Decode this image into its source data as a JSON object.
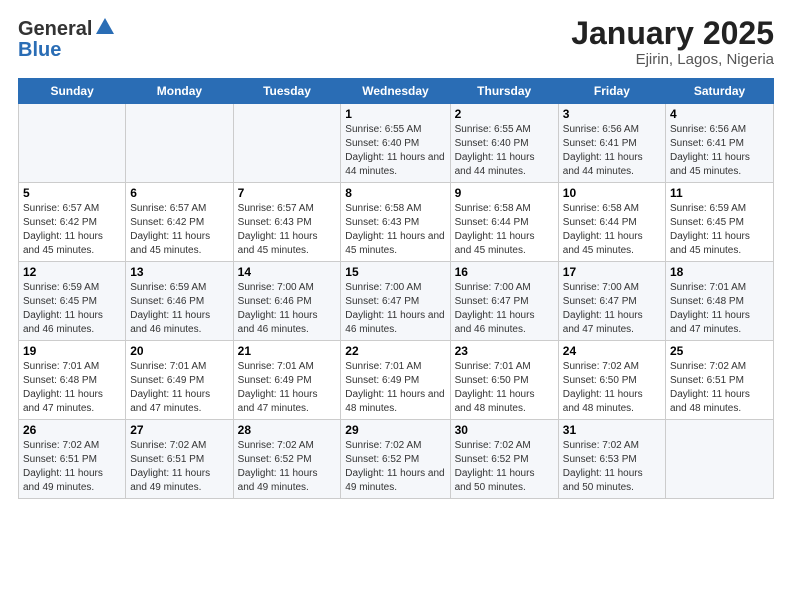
{
  "header": {
    "logo_general": "General",
    "logo_blue": "Blue",
    "title": "January 2025",
    "subtitle": "Ejirin, Lagos, Nigeria"
  },
  "days_of_week": [
    "Sunday",
    "Monday",
    "Tuesday",
    "Wednesday",
    "Thursday",
    "Friday",
    "Saturday"
  ],
  "weeks": [
    [
      {
        "day": "",
        "info": ""
      },
      {
        "day": "",
        "info": ""
      },
      {
        "day": "",
        "info": ""
      },
      {
        "day": "1",
        "info": "Sunrise: 6:55 AM\nSunset: 6:40 PM\nDaylight: 11 hours and 44 minutes."
      },
      {
        "day": "2",
        "info": "Sunrise: 6:55 AM\nSunset: 6:40 PM\nDaylight: 11 hours and 44 minutes."
      },
      {
        "day": "3",
        "info": "Sunrise: 6:56 AM\nSunset: 6:41 PM\nDaylight: 11 hours and 44 minutes."
      },
      {
        "day": "4",
        "info": "Sunrise: 6:56 AM\nSunset: 6:41 PM\nDaylight: 11 hours and 45 minutes."
      }
    ],
    [
      {
        "day": "5",
        "info": "Sunrise: 6:57 AM\nSunset: 6:42 PM\nDaylight: 11 hours and 45 minutes."
      },
      {
        "day": "6",
        "info": "Sunrise: 6:57 AM\nSunset: 6:42 PM\nDaylight: 11 hours and 45 minutes."
      },
      {
        "day": "7",
        "info": "Sunrise: 6:57 AM\nSunset: 6:43 PM\nDaylight: 11 hours and 45 minutes."
      },
      {
        "day": "8",
        "info": "Sunrise: 6:58 AM\nSunset: 6:43 PM\nDaylight: 11 hours and 45 minutes."
      },
      {
        "day": "9",
        "info": "Sunrise: 6:58 AM\nSunset: 6:44 PM\nDaylight: 11 hours and 45 minutes."
      },
      {
        "day": "10",
        "info": "Sunrise: 6:58 AM\nSunset: 6:44 PM\nDaylight: 11 hours and 45 minutes."
      },
      {
        "day": "11",
        "info": "Sunrise: 6:59 AM\nSunset: 6:45 PM\nDaylight: 11 hours and 45 minutes."
      }
    ],
    [
      {
        "day": "12",
        "info": "Sunrise: 6:59 AM\nSunset: 6:45 PM\nDaylight: 11 hours and 46 minutes."
      },
      {
        "day": "13",
        "info": "Sunrise: 6:59 AM\nSunset: 6:46 PM\nDaylight: 11 hours and 46 minutes."
      },
      {
        "day": "14",
        "info": "Sunrise: 7:00 AM\nSunset: 6:46 PM\nDaylight: 11 hours and 46 minutes."
      },
      {
        "day": "15",
        "info": "Sunrise: 7:00 AM\nSunset: 6:47 PM\nDaylight: 11 hours and 46 minutes."
      },
      {
        "day": "16",
        "info": "Sunrise: 7:00 AM\nSunset: 6:47 PM\nDaylight: 11 hours and 46 minutes."
      },
      {
        "day": "17",
        "info": "Sunrise: 7:00 AM\nSunset: 6:47 PM\nDaylight: 11 hours and 47 minutes."
      },
      {
        "day": "18",
        "info": "Sunrise: 7:01 AM\nSunset: 6:48 PM\nDaylight: 11 hours and 47 minutes."
      }
    ],
    [
      {
        "day": "19",
        "info": "Sunrise: 7:01 AM\nSunset: 6:48 PM\nDaylight: 11 hours and 47 minutes."
      },
      {
        "day": "20",
        "info": "Sunrise: 7:01 AM\nSunset: 6:49 PM\nDaylight: 11 hours and 47 minutes."
      },
      {
        "day": "21",
        "info": "Sunrise: 7:01 AM\nSunset: 6:49 PM\nDaylight: 11 hours and 47 minutes."
      },
      {
        "day": "22",
        "info": "Sunrise: 7:01 AM\nSunset: 6:49 PM\nDaylight: 11 hours and 48 minutes."
      },
      {
        "day": "23",
        "info": "Sunrise: 7:01 AM\nSunset: 6:50 PM\nDaylight: 11 hours and 48 minutes."
      },
      {
        "day": "24",
        "info": "Sunrise: 7:02 AM\nSunset: 6:50 PM\nDaylight: 11 hours and 48 minutes."
      },
      {
        "day": "25",
        "info": "Sunrise: 7:02 AM\nSunset: 6:51 PM\nDaylight: 11 hours and 48 minutes."
      }
    ],
    [
      {
        "day": "26",
        "info": "Sunrise: 7:02 AM\nSunset: 6:51 PM\nDaylight: 11 hours and 49 minutes."
      },
      {
        "day": "27",
        "info": "Sunrise: 7:02 AM\nSunset: 6:51 PM\nDaylight: 11 hours and 49 minutes."
      },
      {
        "day": "28",
        "info": "Sunrise: 7:02 AM\nSunset: 6:52 PM\nDaylight: 11 hours and 49 minutes."
      },
      {
        "day": "29",
        "info": "Sunrise: 7:02 AM\nSunset: 6:52 PM\nDaylight: 11 hours and 49 minutes."
      },
      {
        "day": "30",
        "info": "Sunrise: 7:02 AM\nSunset: 6:52 PM\nDaylight: 11 hours and 50 minutes."
      },
      {
        "day": "31",
        "info": "Sunrise: 7:02 AM\nSunset: 6:53 PM\nDaylight: 11 hours and 50 minutes."
      },
      {
        "day": "",
        "info": ""
      }
    ]
  ]
}
